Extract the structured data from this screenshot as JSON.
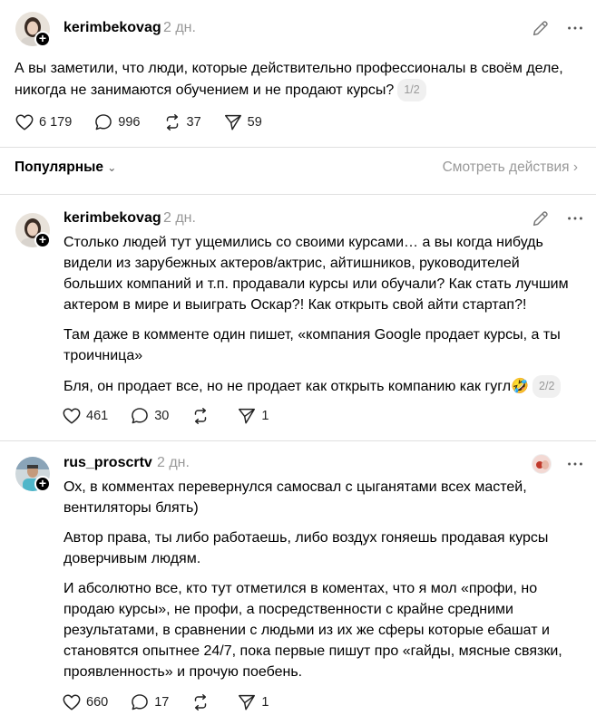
{
  "post1": {
    "username": "kerimbekovag",
    "time": "2 дн.",
    "text": "А вы заметили, что люди, которые действительно профессионалы в своём деле, никогда не занимаются обучением и не продают курсы?",
    "pager": "1/2",
    "likes": "6 179",
    "comments": "996",
    "reposts": "37",
    "shares": "59"
  },
  "filter": {
    "label": "Популярные",
    "see_activity": "Смотреть действия"
  },
  "post2": {
    "username": "kerimbekovag",
    "time": "2 дн.",
    "paragraphs": [
      "Столько людей тут ущемились со своими курсами… а вы когда нибудь видели из зарубежных актеров/актрис, айтишников, руководителей больших компаний и т.п. продавали курсы или обучали? Как стать лучшим актером в мире и выиграть Оскар?! Как открыть свой айти стартап?!",
      "Там даже в комменте один пишет, «компания Google продает курсы, а ты троичница»",
      "Бля, он продает все, но не продает как открыть компанию как гугл🤣"
    ],
    "pager": "2/2",
    "likes": "461",
    "comments": "30",
    "reposts": "",
    "shares": "1"
  },
  "post3": {
    "username": "rus_proscrtv",
    "time": "2 дн.",
    "paragraphs": [
      "Ох, в комментах перевернулся самосвал с цыганятами всех мастей, вентиляторы блять)",
      "Автор права, ты либо работаешь, либо воздух гоняешь продавая курсы доверчивым людям.",
      "И абсолютно все, кто тут отметился в коментах, что я мол «профи, но продаю курсы», не профи, а посредственности с крайне средними результатами, в сравнении с людьми из их же сферы которые ебашат и становятся опытнее 24/7, пока первые пишут про «гайды, мясные связки, проявленность» и прочую поебень."
    ],
    "likes": "660",
    "comments": "17",
    "reposts": "",
    "shares": "1"
  },
  "icons": {
    "like": "heart-icon",
    "comment": "speech-bubble-icon",
    "repost": "repost-arrows-icon",
    "share": "paper-plane-icon",
    "edit": "pencil-icon",
    "more": "ellipsis-icon"
  },
  "colors": {
    "text": "#000000",
    "muted": "#999999",
    "divider": "#e0e0e0"
  }
}
